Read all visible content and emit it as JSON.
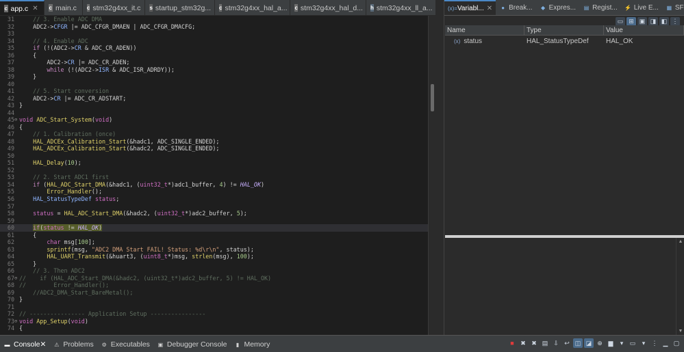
{
  "editor": {
    "tabs": [
      {
        "label": "app.c",
        "icon": "c-file-icon",
        "kind": "c",
        "active": true
      },
      {
        "label": "main.c",
        "icon": "c-file-icon",
        "kind": "c",
        "active": false
      },
      {
        "label": "stm32g4xx_it.c",
        "icon": "c-file-icon",
        "kind": "c",
        "active": false
      },
      {
        "label": "startup_stm32g...",
        "icon": "s-file-icon",
        "kind": "s",
        "active": false
      },
      {
        "label": "stm32g4xx_hal_a...",
        "icon": "c-file-icon",
        "kind": "c",
        "active": false
      },
      {
        "label": "stm32g4xx_hal_d...",
        "icon": "c-file-icon",
        "kind": "c",
        "active": false
      },
      {
        "label": "stm32g4xx_ll_a...",
        "icon": "h-file-icon",
        "kind": "h",
        "active": false
      }
    ],
    "lines": [
      {
        "n": "31",
        "parts": [
          [
            "cm",
            "    // 3. Enable ADC DMA"
          ]
        ]
      },
      {
        "n": "32",
        "parts": [
          [
            "",
            "    ADC2->"
          ],
          [
            "mc",
            "CFGR"
          ],
          [
            "",
            " |= ADC_CFGR_DMAEN | ADC_CFGR_DMACFG;"
          ]
        ]
      },
      {
        "n": "33",
        "parts": []
      },
      {
        "n": "34",
        "parts": [
          [
            "cm",
            "    // 4. Enable ADC"
          ]
        ]
      },
      {
        "n": "35",
        "parts": [
          [
            "kw",
            "    if"
          ],
          [
            "",
            " (!(ADC2->"
          ],
          [
            "mc",
            "CR"
          ],
          [
            "",
            " & ADC_CR_ADEN))"
          ]
        ]
      },
      {
        "n": "36",
        "parts": [
          [
            "",
            "    {"
          ]
        ]
      },
      {
        "n": "37",
        "parts": [
          [
            "",
            "        ADC2->"
          ],
          [
            "mc",
            "CR"
          ],
          [
            "",
            " |= ADC_CR_ADEN;"
          ]
        ]
      },
      {
        "n": "38",
        "parts": [
          [
            "kw",
            "        while"
          ],
          [
            "",
            " (!(ADC2->"
          ],
          [
            "mc",
            "ISR"
          ],
          [
            "",
            " & ADC_ISR_ADRDY));"
          ]
        ]
      },
      {
        "n": "39",
        "parts": [
          [
            "",
            "    }"
          ]
        ]
      },
      {
        "n": "40",
        "parts": []
      },
      {
        "n": "41",
        "parts": [
          [
            "cm",
            "    // 5. Start conversion"
          ]
        ]
      },
      {
        "n": "42",
        "parts": [
          [
            "",
            "    ADC2->"
          ],
          [
            "mc",
            "CR"
          ],
          [
            "",
            " |= ADC_CR_ADSTART;"
          ]
        ]
      },
      {
        "n": "43",
        "parts": [
          [
            "",
            "}"
          ]
        ]
      },
      {
        "n": "44",
        "parts": []
      },
      {
        "n": "45",
        "fold": "⊖",
        "parts": [
          [
            "kt",
            "void"
          ],
          [
            "",
            " "
          ],
          [
            "fn",
            "ADC_Start_System"
          ],
          [
            "",
            "("
          ],
          [
            "kt",
            "void"
          ],
          [
            "",
            ")"
          ]
        ]
      },
      {
        "n": "46",
        "parts": [
          [
            "",
            "{"
          ]
        ]
      },
      {
        "n": "47",
        "parts": [
          [
            "cm",
            "    // 1. Calibration (once)"
          ]
        ]
      },
      {
        "n": "48",
        "parts": [
          [
            "fn",
            "    HAL_ADCEx_Calibration_Start"
          ],
          [
            "",
            "(&hadc1, ADC_SINGLE_ENDED);"
          ]
        ]
      },
      {
        "n": "49",
        "parts": [
          [
            "fn",
            "    HAL_ADCEx_Calibration_Start"
          ],
          [
            "",
            "(&hadc2, ADC_SINGLE_ENDED);"
          ]
        ]
      },
      {
        "n": "50",
        "parts": []
      },
      {
        "n": "51",
        "parts": [
          [
            "fn",
            "    HAL_Delay"
          ],
          [
            "",
            "("
          ],
          [
            "nm",
            "10"
          ],
          [
            "",
            ");"
          ]
        ]
      },
      {
        "n": "52",
        "parts": []
      },
      {
        "n": "53",
        "parts": [
          [
            "cm",
            "    // 2. Start ADC1 first"
          ]
        ]
      },
      {
        "n": "54",
        "parts": [
          [
            "kw",
            "    if"
          ],
          [
            "",
            " ("
          ],
          [
            "fn",
            "HAL_ADC_Start_DMA"
          ],
          [
            "",
            "(&hadc1, ("
          ],
          [
            "kt",
            "uint32_t"
          ],
          [
            "",
            "*)adc1_buffer, "
          ],
          [
            "nm",
            "4"
          ],
          [
            "",
            ") != "
          ],
          [
            "it",
            "HAL_OK"
          ],
          [
            "",
            ")"
          ]
        ]
      },
      {
        "n": "55",
        "parts": [
          [
            "fn",
            "        Error_Handler"
          ],
          [
            "",
            "();"
          ]
        ]
      },
      {
        "n": "56",
        "parts": [
          [
            "mc",
            "    HAL_StatusTypeDef"
          ],
          [
            "",
            " "
          ],
          [
            "kt",
            "status"
          ],
          [
            "",
            ";"
          ]
        ]
      },
      {
        "n": "57",
        "parts": []
      },
      {
        "n": "58",
        "parts": [
          [
            "",
            "    "
          ],
          [
            "kt",
            "status"
          ],
          [
            "",
            " = "
          ],
          [
            "fn",
            "HAL_ADC_Start_DMA"
          ],
          [
            "",
            "(&hadc2, ("
          ],
          [
            "kt",
            "uint32_t"
          ],
          [
            "",
            "*)adc2_buffer, "
          ],
          [
            "nm",
            "5"
          ],
          [
            "",
            ");"
          ]
        ]
      },
      {
        "n": "59",
        "parts": []
      },
      {
        "n": "60",
        "hl": true,
        "parts": [
          [
            "",
            "    "
          ],
          [
            "kw sel",
            "if"
          ],
          [
            "sel",
            "("
          ],
          [
            "kt sel",
            "status"
          ],
          [
            "sel",
            " != "
          ],
          [
            "it sel",
            "HAL_OK"
          ],
          [
            "sel",
            ")"
          ]
        ]
      },
      {
        "n": "61",
        "parts": [
          [
            "",
            "    {"
          ]
        ]
      },
      {
        "n": "62",
        "parts": [
          [
            "kt",
            "        char"
          ],
          [
            "",
            " msg["
          ],
          [
            "nm",
            "100"
          ],
          [
            "",
            "];"
          ]
        ]
      },
      {
        "n": "63",
        "parts": [
          [
            "fn",
            "        sprintf"
          ],
          [
            "",
            "(msg, "
          ],
          [
            "str",
            "\"ADC2 DMA Start FAIL! Status: %d\\r\\n\""
          ],
          [
            "",
            ", status);"
          ]
        ]
      },
      {
        "n": "64",
        "parts": [
          [
            "fn",
            "        HAL_UART_Transmit"
          ],
          [
            "",
            "(&huart3, ("
          ],
          [
            "kt",
            "uint8_t"
          ],
          [
            "",
            "*)msg, "
          ],
          [
            "fn",
            "strlen"
          ],
          [
            "",
            "(msg), "
          ],
          [
            "nm",
            "100"
          ],
          [
            "",
            ");"
          ]
        ]
      },
      {
        "n": "65",
        "parts": [
          [
            "",
            "    }"
          ]
        ]
      },
      {
        "n": "66",
        "parts": [
          [
            "cm",
            "    // 3. Then ADC2"
          ]
        ]
      },
      {
        "n": "67",
        "fold": "⊖",
        "parts": [
          [
            "cm",
            "//    if (HAL_ADC_Start_DMA(&hadc2, (uint32_t*)adc2_buffer, 5) != HAL_OK)"
          ]
        ]
      },
      {
        "n": "68",
        "parts": [
          [
            "cm",
            "//        Error_Handler();"
          ]
        ]
      },
      {
        "n": "69",
        "parts": [
          [
            "cm",
            "    //ADC2_DMA_Start_BareMetal();"
          ]
        ]
      },
      {
        "n": "70",
        "parts": [
          [
            "",
            "}"
          ]
        ]
      },
      {
        "n": "71",
        "parts": []
      },
      {
        "n": "72",
        "parts": [
          [
            "cm",
            "// ---------------- Application Setup ----------------"
          ]
        ]
      },
      {
        "n": "73",
        "fold": "⊖",
        "parts": [
          [
            "kt",
            "void"
          ],
          [
            "",
            " "
          ],
          [
            "fn",
            "App_Setup"
          ],
          [
            "",
            "("
          ],
          [
            "kt",
            "void"
          ],
          [
            "",
            ")"
          ]
        ]
      },
      {
        "n": "74",
        "parts": [
          [
            "",
            "{"
          ]
        ]
      }
    ]
  },
  "rightpane": {
    "tabs": [
      {
        "label": "Variabl...",
        "icon": "variables-icon",
        "glyph": "(x)=",
        "active": true,
        "closable": true
      },
      {
        "label": "Break...",
        "icon": "breakpoints-icon",
        "glyph": "●",
        "active": false,
        "closable": false
      },
      {
        "label": "Expres...",
        "icon": "expressions-icon",
        "glyph": "◆",
        "active": false,
        "closable": false
      },
      {
        "label": "Regist...",
        "icon": "registers-icon",
        "glyph": "▤",
        "active": false,
        "closable": false
      },
      {
        "label": "Live E...",
        "icon": "live-expressions-icon",
        "glyph": "⚡",
        "active": false,
        "closable": false
      },
      {
        "label": "SFRs",
        "icon": "sfrs-icon",
        "glyph": "▦",
        "active": false,
        "closable": false
      }
    ],
    "toolbar": [
      {
        "name": "show-type-names-icon",
        "glyph": "▭",
        "on": false
      },
      {
        "name": "show-logical-structure-icon",
        "glyph": "⊞",
        "on": true
      },
      {
        "name": "collapse-all-icon",
        "glyph": "▣",
        "on": false
      },
      {
        "name": "add-global-variables-icon",
        "glyph": "◨",
        "on": false
      },
      {
        "name": "remove-global-variables-icon",
        "glyph": "◧",
        "on": false
      },
      {
        "name": "view-menu-icon",
        "glyph": "⋮",
        "on": false
      }
    ],
    "columns": [
      "Name",
      "Type",
      "Value"
    ],
    "variables": [
      {
        "name": "status",
        "type": "HAL_StatusTypeDef",
        "value": "HAL_OK"
      }
    ]
  },
  "console": {
    "tabs": [
      {
        "label": "Console",
        "icon": "console-icon",
        "glyph": "▬",
        "active": true,
        "closable": true
      },
      {
        "label": "Problems",
        "icon": "problems-icon",
        "glyph": "⚠",
        "active": false,
        "closable": false
      },
      {
        "label": "Executables",
        "icon": "executables-icon",
        "glyph": "⚙",
        "active": false,
        "closable": false
      },
      {
        "label": "Debugger Console",
        "icon": "debugger-console-icon",
        "glyph": "▣",
        "active": false,
        "closable": false
      },
      {
        "label": "Memory",
        "icon": "memory-icon",
        "glyph": "▮",
        "active": false,
        "closable": false
      }
    ],
    "toolbar": [
      {
        "name": "terminate-icon",
        "glyph": "■",
        "cls": "stop"
      },
      {
        "name": "remove-launch-icon",
        "glyph": "✖",
        "cls": ""
      },
      {
        "name": "remove-all-terminated-icon",
        "glyph": "✖",
        "cls": ""
      },
      {
        "name": "clear-console-icon",
        "glyph": "▤",
        "cls": ""
      },
      {
        "name": "scroll-lock-icon",
        "glyph": "⇩",
        "cls": ""
      },
      {
        "name": "word-wrap-icon",
        "glyph": "↩",
        "cls": ""
      },
      {
        "name": "show-when-stdout-icon",
        "glyph": "◫",
        "cls": "on"
      },
      {
        "name": "show-when-stderr-icon",
        "glyph": "◪",
        "cls": "on"
      },
      {
        "name": "pin-console-icon",
        "glyph": "⊕",
        "cls": ""
      },
      {
        "name": "display-selected-console-icon",
        "glyph": "▆",
        "cls": ""
      },
      {
        "name": "display-selected-console-dropdown-icon",
        "glyph": "▾",
        "cls": ""
      },
      {
        "name": "open-console-icon",
        "glyph": "▭",
        "cls": ""
      },
      {
        "name": "open-console-dropdown-icon",
        "glyph": "▾",
        "cls": ""
      },
      {
        "name": "view-menu-icon",
        "glyph": "⋮",
        "cls": ""
      },
      {
        "name": "minimize-icon",
        "glyph": "▁",
        "cls": ""
      },
      {
        "name": "maximize-icon",
        "glyph": "▢",
        "cls": ""
      }
    ]
  }
}
